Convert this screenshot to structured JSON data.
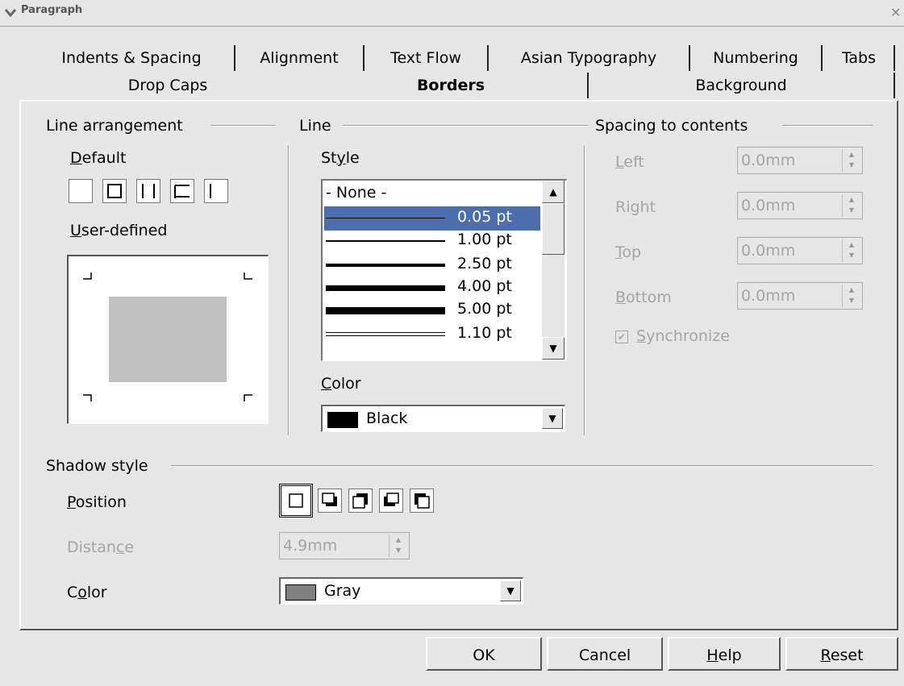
{
  "window": {
    "title": "Paragraph"
  },
  "tabs_row1": [
    "Indents & Spacing",
    "Alignment",
    "Text Flow",
    "Asian Typography",
    "Numbering",
    "Tabs"
  ],
  "tabs_row2": [
    "Drop Caps",
    "Borders",
    "Background"
  ],
  "active_tab": "Borders",
  "line_arrangement": {
    "title": "Line arrangement",
    "default_label": "Default",
    "user_defined_label": "User-defined"
  },
  "line": {
    "title": "Line",
    "style_label": "Style",
    "styles": [
      {
        "label": "- None -"
      },
      {
        "label": "0.05 pt"
      },
      {
        "label": "1.00 pt"
      },
      {
        "label": "2.50 pt"
      },
      {
        "label": "4.00 pt"
      },
      {
        "label": "5.00 pt"
      },
      {
        "label": "1.10 pt"
      }
    ],
    "selected_style": "0.05 pt",
    "color_label": "Color",
    "color_value": "Black",
    "color_swatch": "#000000"
  },
  "spacing": {
    "title": "Spacing to contents",
    "left_label": "Left",
    "left_value": "0.0mm",
    "right_label": "Right",
    "right_value": "0.0mm",
    "top_label": "Top",
    "top_value": "0.0mm",
    "bottom_label": "Bottom",
    "bottom_value": "0.0mm",
    "synchronize_label": "Synchronize",
    "synchronize_checked": true
  },
  "shadow": {
    "title": "Shadow style",
    "position_label": "Position",
    "distance_label": "Distance",
    "distance_value": "4.9mm",
    "color_label": "Color",
    "color_value": "Gray",
    "color_swatch": "#808080"
  },
  "buttons": {
    "ok": "OK",
    "cancel": "Cancel",
    "help": "Help",
    "reset": "Reset"
  },
  "colors": {
    "selection": "#4b6eaf",
    "background": "#e6e6e6"
  }
}
